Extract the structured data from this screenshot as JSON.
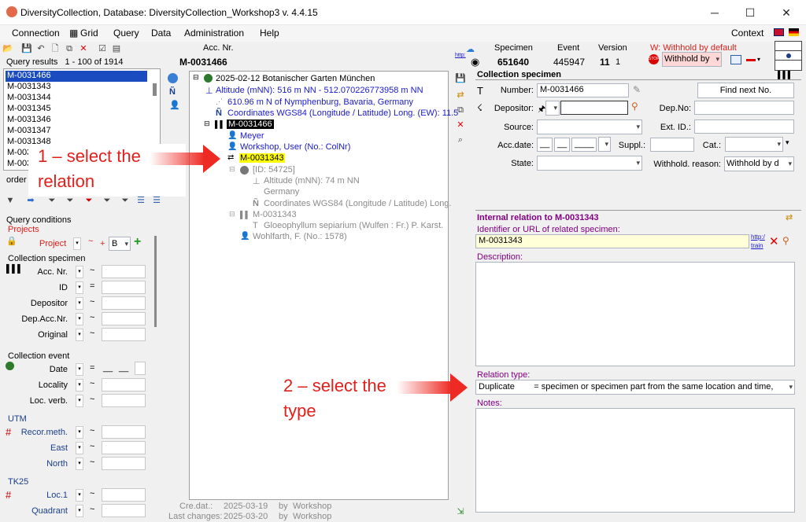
{
  "window": {
    "title": "DiversityCollection,  Database: DiversityCollection_Workshop3    v. 4.4.15"
  },
  "menu": [
    "Connection",
    "Grid",
    "Query",
    "Data",
    "Administration",
    "Help"
  ],
  "menu_right": "Context",
  "query_results": {
    "label": "Query results",
    "count": "1 - 100 of 1914",
    "items": [
      "M-0031466",
      "M-0031343",
      "M-0031344",
      "M-0031345",
      "M-0031346",
      "M-0031347",
      "M-0031348",
      "M-0031349",
      "M-0031350"
    ]
  },
  "order_label": "order b",
  "query_conditions": {
    "label": "Query conditions",
    "projects_label": "Projects",
    "project_label": "Project",
    "project_value": "B",
    "collection_specimen": "Collection specimen",
    "cs_fields": [
      {
        "label": "Acc. Nr.",
        "op": "~"
      },
      {
        "label": "ID",
        "op": "="
      },
      {
        "label": "Depositor",
        "op": "~"
      },
      {
        "label": "Dep.Acc.Nr.",
        "op": "~"
      },
      {
        "label": "Original",
        "op": "~"
      }
    ],
    "collection_event": "Collection event",
    "ce_fields": [
      {
        "label": "Date",
        "op": "="
      },
      {
        "label": "Locality",
        "op": "~"
      },
      {
        "label": "Loc. verb.",
        "op": "~"
      }
    ],
    "utm": "UTM",
    "utm_fields": [
      {
        "label": "Recor.meth.",
        "op": "~"
      },
      {
        "label": "East",
        "op": "~"
      },
      {
        "label": "North",
        "op": "~"
      }
    ],
    "tk25": "TK25",
    "tk_fields": [
      {
        "label": "Loc.1",
        "op": "~"
      },
      {
        "label": "Quadrant",
        "op": "~"
      }
    ]
  },
  "header": {
    "acc_nr_label": "Acc. Nr.",
    "acc_nr_value": "M-0031466",
    "http": "http:",
    "specimen_label": "Specimen",
    "specimen_value": "651640",
    "event_label": "Event",
    "event_value": "445947",
    "version_label": "Version",
    "version_value": "11",
    "version_sub": "1",
    "withhold_text": "W: Withhold by default",
    "withhold_value": "Withhold by"
  },
  "tree": {
    "event": "2025-02-12 Botanischer Garten München",
    "altitude": "Altitude (mNN): 516 m NN - 512.070226773958 m NN",
    "distance": "610.96 m N of Nymphenburg, Bavaria, Germany",
    "coordinates": "Coordinates WGS84 (Longitude / Latitude) Long. (EW): 11.5",
    "specimen": "M-0031466",
    "agent": "Meyer",
    "workshop": "Workshop, User (No.: ColNr)",
    "relation": "M-0031343",
    "rel_id": "[ID: 54725]",
    "rel_altitude": "Altitude (mNN): 74 m NN",
    "rel_country": "Germany",
    "rel_coords": "Coordinates WGS84 (Longitude / Latitude) Long.",
    "rel_specimen": "M-0031343",
    "rel_taxon": "Gloeophyllum sepiarium (Wulfen : Fr.) P. Karst.",
    "rel_agent": "Wohlfarth, F. (No.: 1578)"
  },
  "footer": {
    "cre_label": "Cre.dat.:",
    "cre_date": "2025-03-19",
    "cre_by": "by",
    "cre_user": "Workshop",
    "last_label": "Last changes:",
    "last_date": "2025-03-20",
    "last_by": "by",
    "last_user": "Workshop"
  },
  "collection_specimen": {
    "title": "Collection specimen",
    "number_label": "Number:",
    "number_value": "M-0031466",
    "find_next": "Find next No.",
    "depositor_label": "Depositor:",
    "depno_label": "Dep.No:",
    "source_label": "Source:",
    "extid_label": "Ext. ID.:",
    "accdate_label": "Acc.date:",
    "suppl_label": "Suppl.:",
    "cat_label": "Cat.:",
    "state_label": "State:",
    "withhold_label": "Withhold. reason:",
    "withhold_value": "Withhold by d"
  },
  "relation": {
    "title": "Internal relation to M-0031343",
    "identifier_label": "Identifier or URL of related specimen:",
    "identifier_value": "M-0031343",
    "http": "http:/",
    "train": "train",
    "description_label": "Description:",
    "type_label": "Relation type:",
    "type_value": "Duplicate        = specimen or specimen part from the same location and time,",
    "notes_label": "Notes:"
  },
  "annotations": {
    "callout1_line1": "1 – select the",
    "callout1_line2": "relation",
    "callout2_line1": "2 – select the",
    "callout2_line2": "type"
  },
  "colors": {
    "accent_red": "#e1201c",
    "purple": "#800080",
    "selection": "#1a4bbf",
    "highlight": "#ffff00"
  }
}
